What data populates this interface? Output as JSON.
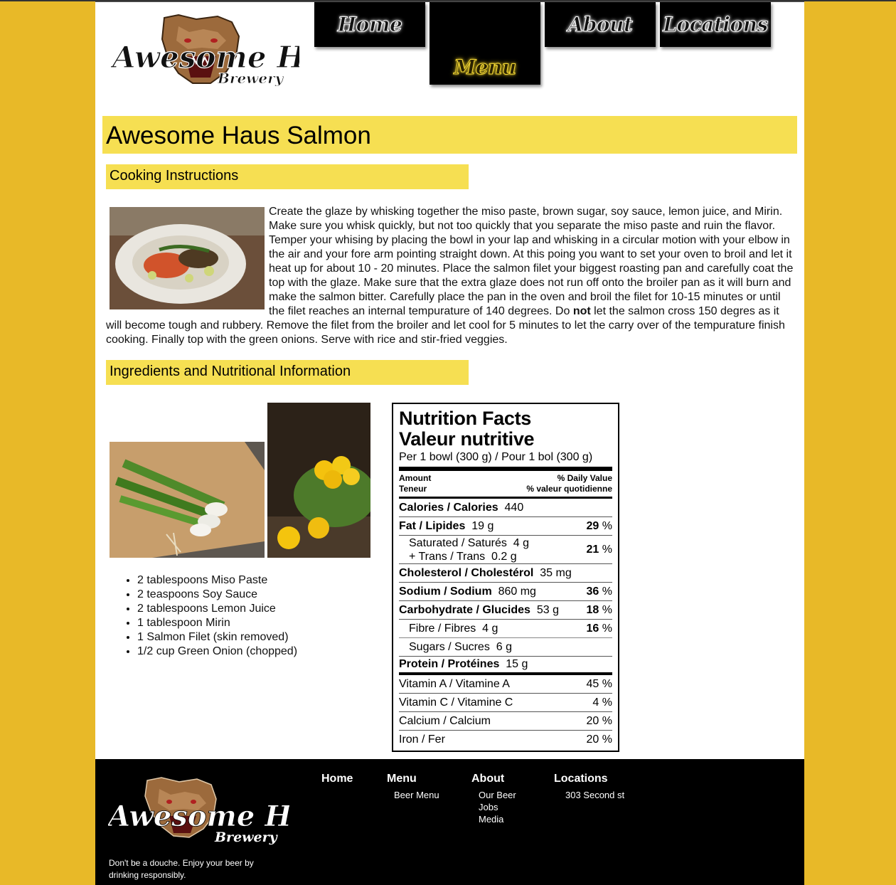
{
  "header": {
    "logo_name": "Awesome Haus",
    "logo_sub": "Brewery",
    "nav": [
      {
        "label": "Home"
      },
      {
        "label": "Menu"
      },
      {
        "label": "About"
      },
      {
        "label": "Locations"
      }
    ]
  },
  "main": {
    "title": "Awesome Haus Salmon",
    "cooking_heading": "Cooking Instructions",
    "instructions_before": "Create the glaze by whisking together the miso paste, brown sugar, soy sauce, lemon juice, and Mirin. Make sure you whisk quickly, but not too quickly that you separate the miso paste and ruin the flavor. Temper your whising by placing the bowl in your lap and whisking in a circular motion with your elbow in the air and your fore arm pointing straight down. At this poing you want to set your oven to broil and let it heat up for about 10 - 20 minutes. Place the salmon filet your biggest roasting pan and carefully coat the top with the glaze. Make sure that the extra glaze does not run off onto the broiler pan as it will burn and make the salmon bitter. Carefully place the pan in the oven and broil the filet for 10-15 minutes or until the filet reaches an internal tempurature of 140 degrees. Do ",
    "instructions_bold": "not",
    "instructions_after": " let the salmon cross 150 degres as it will become tough and rubbery. Remove the filet from the broiler and let cool for 5 minutes to let the carry over of the tempurature finish cooking. Finally top with the green onions. Serve with rice and stir-fried veggies.",
    "ingredients_heading": "Ingredients and Nutritional Information",
    "ingredients": [
      "2 tablespoons Miso Paste",
      "2 teaspoons Soy Sauce",
      "2 tablespoons Lemon Juice",
      "1 tablespoon Mirin",
      "1 Salmon Filet (skin removed)",
      "1/2 cup Green Onion (chopped)"
    ]
  },
  "nutrition": {
    "title_en": "Nutrition Facts",
    "title_fr": "Valeur nutritive",
    "serving": "Per 1 bowl (300 g) / Pour 1 bol (300 g)",
    "amount_en": "Amount",
    "amount_fr": "Teneur",
    "dv_en": "% Daily Value",
    "dv_fr": "% valeur quotidienne",
    "calories_label": "Calories / Calories",
    "calories_value": "440",
    "fat_label": "Fat / Lipides",
    "fat_value": "19 g",
    "fat_pct": "29",
    "sat_label": "Saturated / Saturés",
    "sat_value": "4 g",
    "trans_label": "+ Trans / Trans",
    "trans_value": "0.2 g",
    "sat_trans_pct": "21",
    "chol_label": "Cholesterol / Cholestérol",
    "chol_value": "35 mg",
    "sodium_label": "Sodium / Sodium",
    "sodium_value": "860 mg",
    "sodium_pct": "36",
    "carb_label": "Carbohydrate / Glucides",
    "carb_value": "53 g",
    "carb_pct": "18",
    "fibre_label": "Fibre / Fibres",
    "fibre_value": "4 g",
    "fibre_pct": "16",
    "sugar_label": "Sugars / Sucres",
    "sugar_value": "6 g",
    "protein_label": "Protein / Protéines",
    "protein_value": "15 g",
    "vita_label": "Vitamin A / Vitamine A",
    "vita_pct": "45 %",
    "vitc_label": "Vitamin C / Vitamine C",
    "vitc_pct": "4 %",
    "calcium_label": "Calcium / Calcium",
    "calcium_pct": "20 %",
    "iron_label": "Iron / Fer",
    "iron_pct": "20 %",
    "pct_sign": "%"
  },
  "footer": {
    "disclaimer": "Don't be a douche. Enjoy your beer by drinking responsibly.",
    "cols": [
      {
        "heading": "Home",
        "links": []
      },
      {
        "heading": "Menu",
        "links": [
          "Beer Menu"
        ]
      },
      {
        "heading": "About",
        "links": [
          "Our Beer",
          "Jobs",
          "Media"
        ]
      },
      {
        "heading": "Locations",
        "links": [
          "303 Second st"
        ]
      }
    ]
  },
  "colors": {
    "background": "#e8b928",
    "accent": "#f6df52",
    "nav": "#000000"
  }
}
